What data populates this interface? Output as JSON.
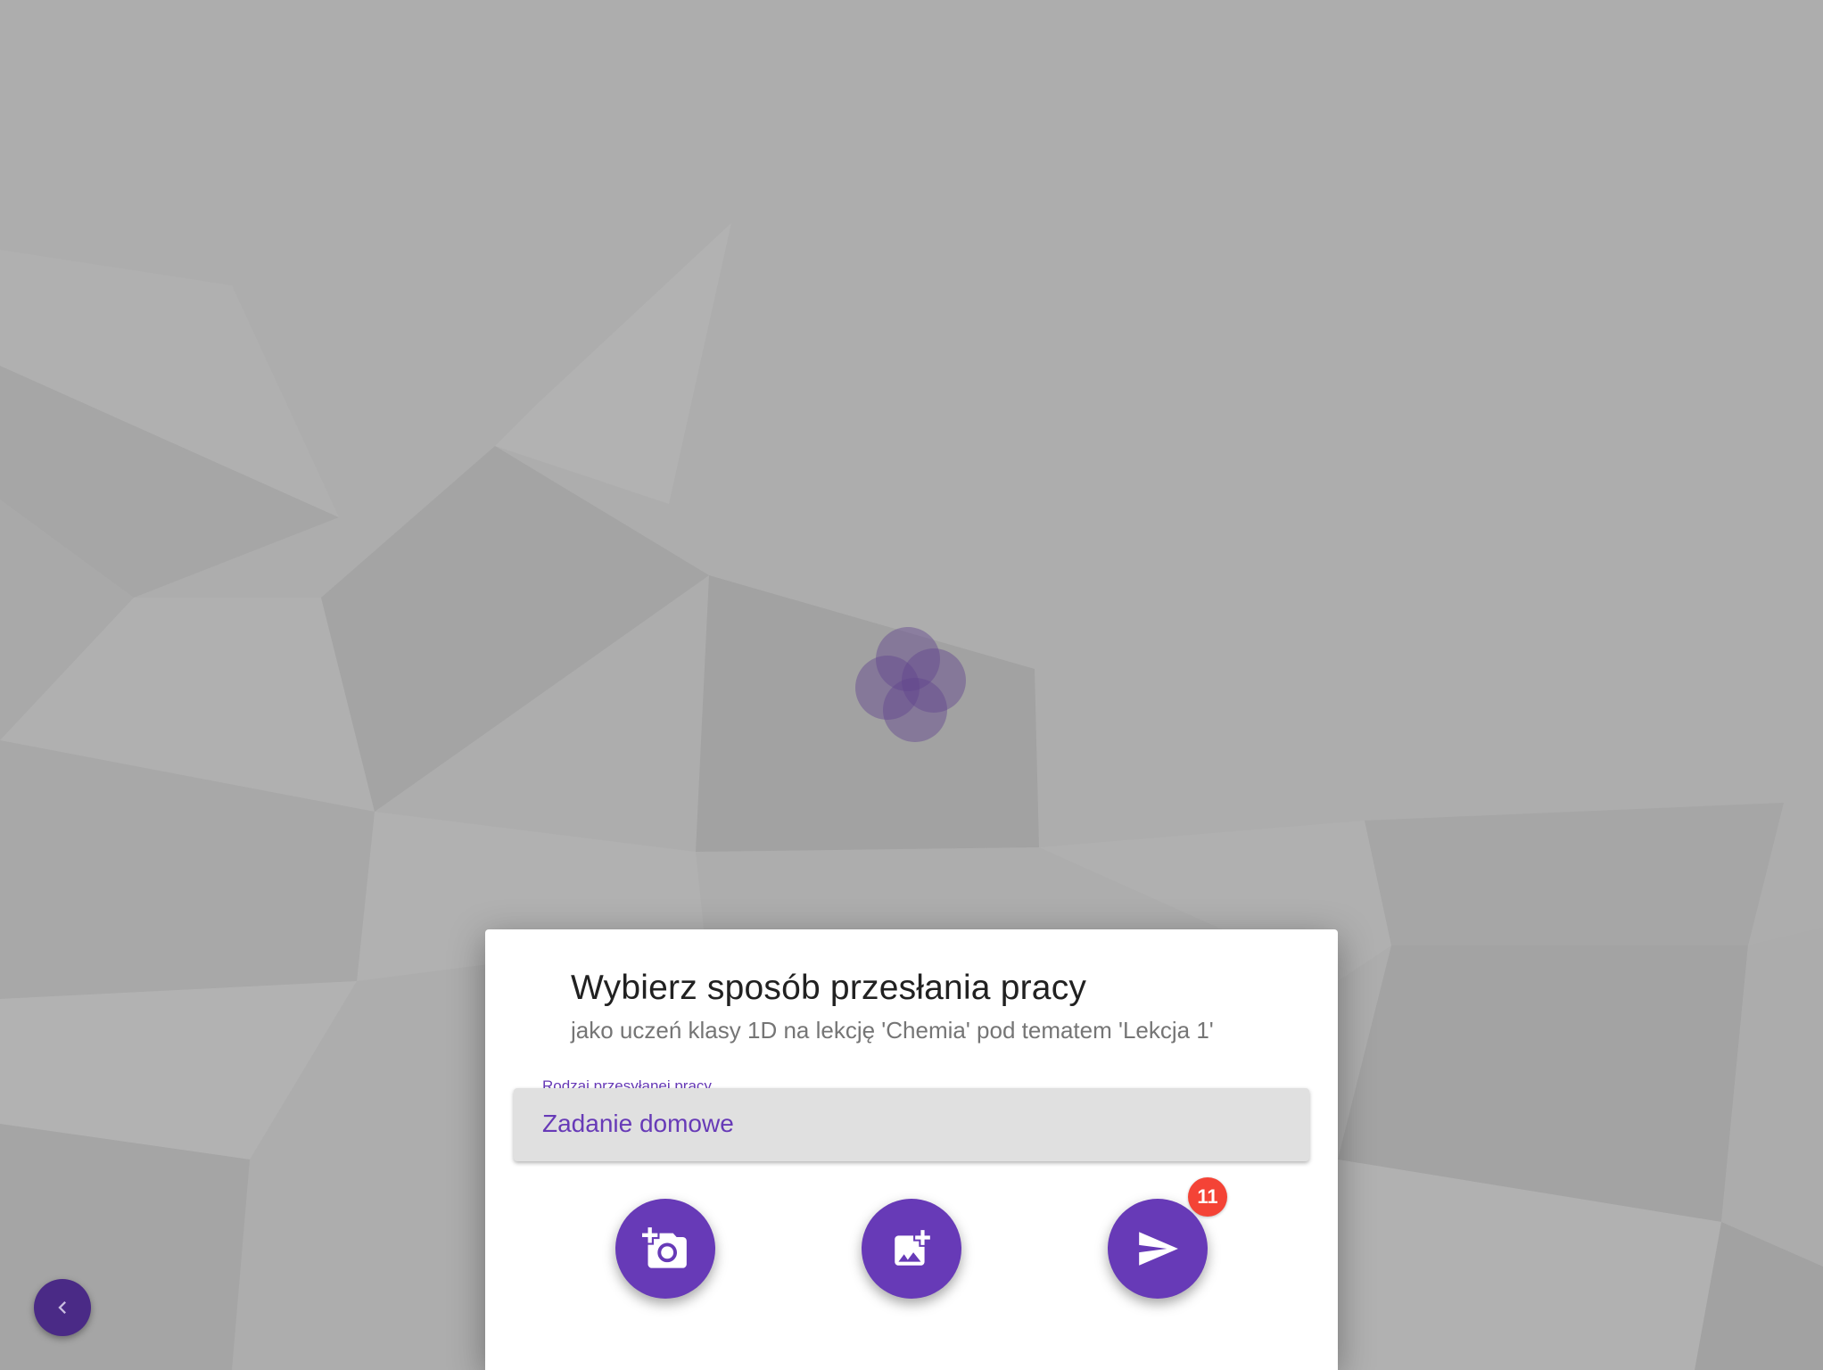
{
  "dialog": {
    "title": "Wybierz sposób przesłania pracy",
    "subtitle": "jako uczeń klasy 1D na lekcję 'Chemia' pod tematem 'Lekcja 1'",
    "select": {
      "label": "Rodzaj przesyłanej pracy",
      "value": "Zadanie domowe"
    },
    "actions": [
      {
        "icon": "add-a-photo-icon"
      },
      {
        "icon": "add-photo-icon"
      },
      {
        "icon": "send-icon",
        "badge": "11"
      }
    ]
  },
  "back_button": {
    "icon": "chevron-left-icon"
  },
  "colors": {
    "accent": "#673ab7",
    "back_button": "#4a2a86",
    "badge": "#f44336",
    "background": "#adadad"
  }
}
